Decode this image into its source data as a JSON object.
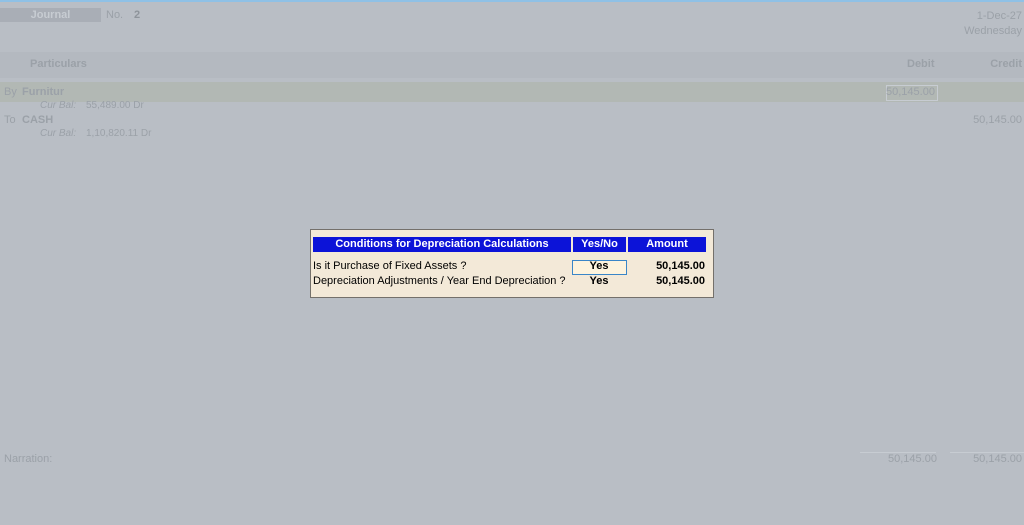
{
  "voucher": {
    "type_label": "Journal",
    "no_label": "No.",
    "no_value": "2",
    "date": "1-Dec-27",
    "day": "Wednesday"
  },
  "columns": {
    "particulars": "Particulars",
    "debit": "Debit",
    "credit": "Credit"
  },
  "entries": [
    {
      "prefix": "By",
      "ledger": "Furnitur",
      "bal_label": "Cur Bal:",
      "bal_value": "55,489.00 Dr",
      "debit": "50,145.00",
      "credit": ""
    },
    {
      "prefix": "To",
      "ledger": "CASH",
      "bal_label": "Cur Bal:",
      "bal_value": "1,10,820.11 Dr",
      "debit": "",
      "credit": "50,145.00"
    }
  ],
  "footer": {
    "narration_label": "Narration:",
    "debit_total": "50,145.00",
    "credit_total": "50,145.00"
  },
  "dialog": {
    "headers": {
      "condition": "Conditions for Depreciation Calculations",
      "yesno": "Yes/No",
      "amount": "Amount"
    },
    "rows": [
      {
        "label": "Is it Purchase of Fixed Assets  ?",
        "yesno": "Yes",
        "amount": "50,145.00"
      },
      {
        "label": "Depreciation Adjustments / Year End Depreciation ?",
        "yesno": "Yes",
        "amount": "50,145.00"
      }
    ]
  }
}
